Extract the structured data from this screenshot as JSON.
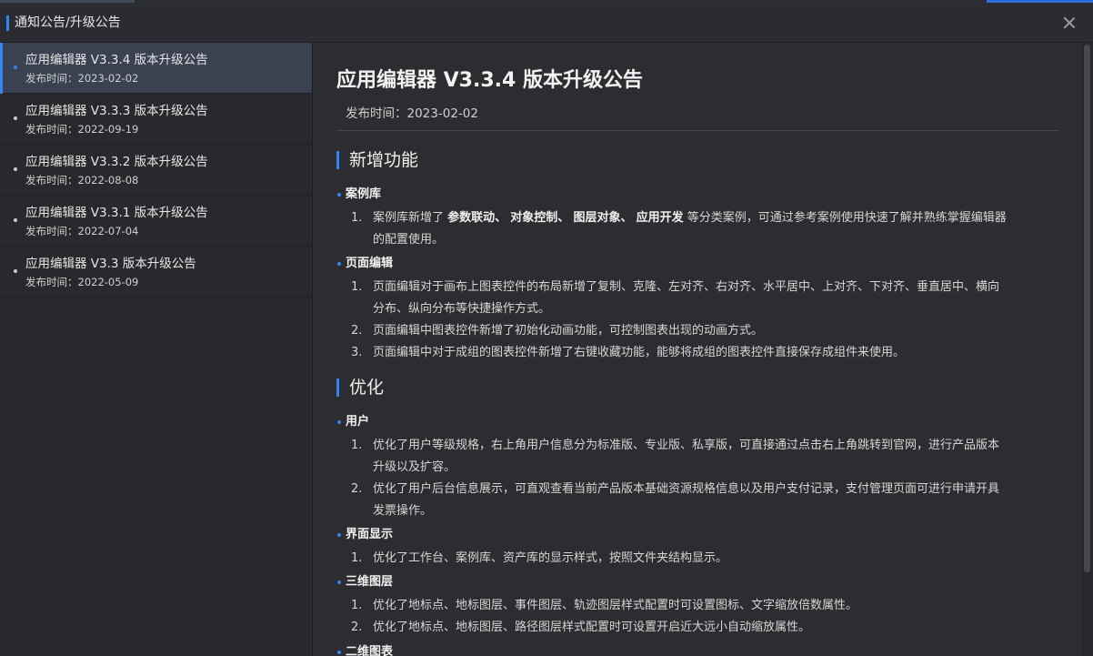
{
  "window": {
    "title": "通知公告/升级公告"
  },
  "sidebar": {
    "items": [
      {
        "name": "应用编辑器 V3.3.4 版本升级公告",
        "date": "发布时间：2023-02-02",
        "active": true
      },
      {
        "name": "应用编辑器 V3.3.3 版本升级公告",
        "date": "发布时间：2022-09-19",
        "active": false
      },
      {
        "name": "应用编辑器 V3.3.2 版本升级公告",
        "date": "发布时间：2022-08-08",
        "active": false
      },
      {
        "name": "应用编辑器 V3.3.1 版本升级公告",
        "date": "发布时间：2022-07-04",
        "active": false
      },
      {
        "name": "应用编辑器 V3.3 版本升级公告",
        "date": "发布时间：2022-05-09",
        "active": false
      }
    ]
  },
  "article": {
    "title": "应用编辑器 V3.3.4 版本升级公告",
    "pubdate": "发布时间：2023-02-02",
    "sections": [
      {
        "title": "新增功能",
        "groups": [
          {
            "name": "案例库",
            "items": [
              {
                "num": "1.",
                "line1_pre": "案例库新增了 ",
                "line1_b1": "参数联动、",
                "line1_b2": "对象控制、",
                "line1_b3": "图层对象、",
                "line1_b4": "应用开发",
                "line1_post": " 等分类案例，可通过参考案例使用快速了解并熟练掌握编辑器",
                "line2": "的配置使用。"
              }
            ]
          },
          {
            "name": "页面编辑",
            "items": [
              {
                "num": "1.",
                "line1": "页面编辑对于画布上图表控件的布局新增了复制、克隆、左对齐、右对齐、水平居中、上对齐、下对齐、垂直居中、横向",
                "line2": "分布、纵向分布等快捷操作方式。"
              },
              {
                "num": "2.",
                "line1": "页面编辑中图表控件新增了初始化动画功能，可控制图表出现的动画方式。"
              },
              {
                "num": "3.",
                "line1": "页面编辑中对于成组的图表控件新增了右键收藏功能，能够将成组的图表控件直接保存成组件来使用。"
              }
            ]
          }
        ]
      },
      {
        "title": "优化",
        "groups": [
          {
            "name": "用户",
            "items": [
              {
                "num": "1.",
                "line1": "优化了用户等级规格，右上角用户信息分为标准版、专业版、私享版，可直接通过点击右上角跳转到官网，进行产品版本",
                "line2": "升级以及扩容。"
              },
              {
                "num": "2.",
                "line1": "优化了用户后台信息展示，可直观查看当前产品版本基础资源规格信息以及用户支付记录，支付管理页面可进行申请开具",
                "line2": "发票操作。"
              }
            ]
          },
          {
            "name": "界面显示",
            "items": [
              {
                "num": "1.",
                "line1": "优化了工作台、案例库、资产库的显示样式，按照文件夹结构显示。"
              }
            ]
          },
          {
            "name": "三维图层",
            "items": [
              {
                "num": "1.",
                "line1": "优化了地标点、地标图层、事件图层、轨迹图层样式配置时可设置图标、文字缩放倍数属性。"
              },
              {
                "num": "2.",
                "line1": "优化了地标点、地标图层、路径图层样式配置时可设置开启近大远小自动缩放属性。"
              }
            ]
          },
          {
            "name": "二维图表",
            "items": []
          }
        ]
      }
    ]
  },
  "colors": {
    "accent": "#2f86f6",
    "background": "#2b2d31",
    "sidebar_active": "#3a4150"
  },
  "icons": {
    "close": "close-icon"
  }
}
